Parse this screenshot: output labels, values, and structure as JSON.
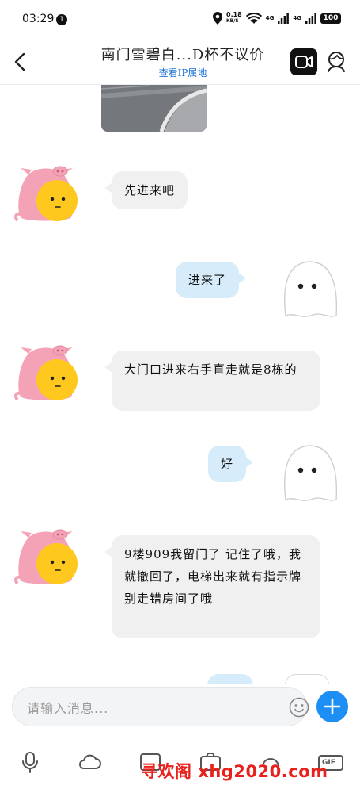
{
  "status_bar": {
    "time": "03:29",
    "notification_count": "1",
    "speed_value": "0.18",
    "speed_unit": "KB/S",
    "network_1": "4G",
    "network_2": "4G",
    "battery": "100"
  },
  "header": {
    "title": "南门雪碧白...D杯不议价",
    "subtitle": "查看IP属地"
  },
  "messages": [
    {
      "direction": "incoming",
      "text": "先进来吧"
    },
    {
      "direction": "outgoing",
      "text": "进来了"
    },
    {
      "direction": "incoming",
      "text": "大门口进来右手直走就是8栋的"
    },
    {
      "direction": "outgoing",
      "text": "好"
    },
    {
      "direction": "incoming",
      "text": "9楼909我留门了 记住了哦，我就撤回了，电梯出来就有指示牌别走错房间了哦"
    }
  ],
  "input": {
    "placeholder": "请输入消息..."
  },
  "toolbar": {
    "icons": [
      "microphone-icon",
      "cloud-icon",
      "image-icon",
      "camera-icon",
      "red-packet-icon",
      "gif-icon"
    ],
    "gif_label": "GIF"
  },
  "watermark": "寻欢阁 xhg2020.com",
  "colors": {
    "accent_blue": "#1d8ef3",
    "link_blue": "#1a73d6",
    "outgoing_bubble": "#d6ecfb",
    "incoming_bubble": "#f0f0f1",
    "watermark_red": "#e8211c",
    "avatar_pink": "#f4a3b6",
    "avatar_yellow": "#ffc81e"
  }
}
